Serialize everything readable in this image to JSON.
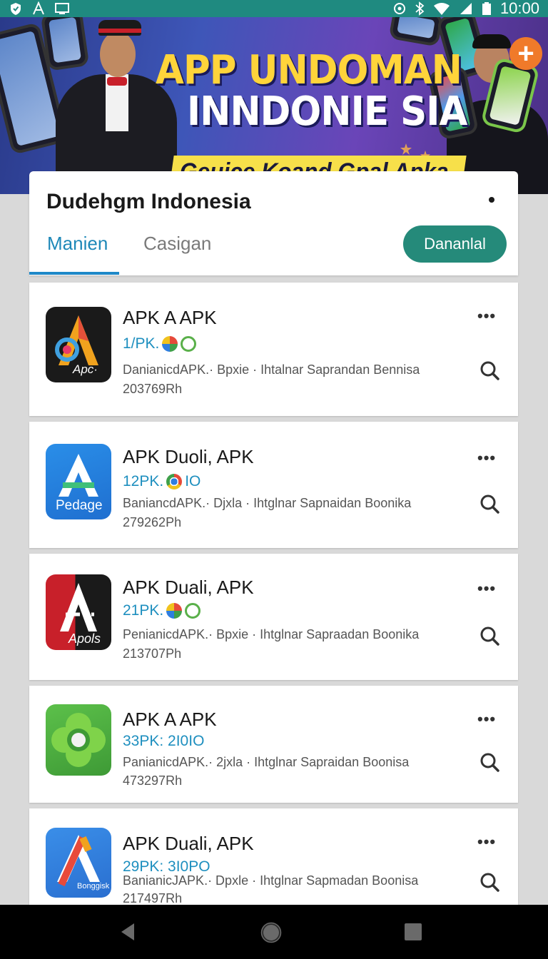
{
  "status_bar": {
    "time": "10:00",
    "left_icons": [
      "shield-icon",
      "font-icon",
      "tv-icon"
    ],
    "right_icons": [
      "location-icon",
      "bluetooth-icon",
      "wifi-icon",
      "signal-icon",
      "battery-icon"
    ]
  },
  "banner": {
    "title_line1": "APP UNDOMAN",
    "title_line2": "INNDONIE SIA",
    "subtitle": "Geuice Koand Gpal Apka",
    "plus_symbol": "+"
  },
  "header": {
    "title": "Dudehgm Indonesia",
    "tabs": [
      {
        "label": "Manien",
        "active": true
      },
      {
        "label": "Casigan",
        "active": false
      }
    ],
    "download_button": "Dananlal"
  },
  "apps": [
    {
      "name": "APK A APK",
      "meta": "1/PK.",
      "meta_tail": "",
      "description": "DanianicdAPK.· Bpxie  · Ihtalnar Saprandan Bennisa",
      "size": "203769Rh",
      "icon_label": "Apc·",
      "icon_name": "apc-app-icon"
    },
    {
      "name": "APK Duoli, APK",
      "meta": "12PK.",
      "meta_tail": "IO",
      "description": "BaniancdAPK.· Djxla  · Ihtglnar Sapnaidan Boonika",
      "size": "279262Ph",
      "icon_label": "Pedage",
      "icon_name": "pedage-app-icon"
    },
    {
      "name": "APK Duali, APK",
      "meta": "21PK.",
      "meta_tail": "",
      "description": "PenianicdAPK.· Bpxie  · Ihtglnar Sapraadan Boonika",
      "size": "213707Ph",
      "icon_label": "Apols",
      "icon_name": "apols-app-icon"
    },
    {
      "name": "APK A APK",
      "meta": "33PK: 2I0IO",
      "meta_tail": "",
      "description": "PanianicdAPK.· 2jxla  · Ihtglnar Sapraidan Boonisa",
      "size": "473297Rh",
      "icon_label": "",
      "icon_name": "green-flower-app-icon"
    },
    {
      "name": "APK Duali, APK",
      "meta": "29PK: 3I0PO",
      "meta_tail": "",
      "description": "BanianicJAPK.· Dpxle  · Ihtglnar Sapmadan Boonisa",
      "size": "217497Rh",
      "icon_label": "Bonggisk",
      "icon_name": "bonggisk-app-icon"
    }
  ],
  "nav_bar": {
    "icons": [
      "back-icon",
      "home-icon",
      "recents-icon"
    ]
  }
}
